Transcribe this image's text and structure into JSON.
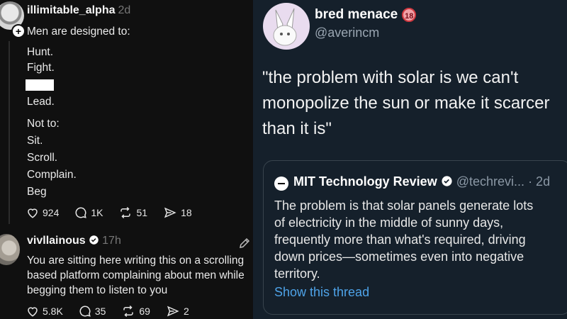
{
  "thread": {
    "post1": {
      "username": "illimitable_alpha",
      "time": "2d",
      "lines": [
        "Men are designed to:",
        "Hunt.",
        "Fight.",
        "Lead.",
        "Not to:",
        "Sit.",
        "Scroll.",
        "Complain.",
        "Beg"
      ],
      "likes": "924",
      "replies": "1K",
      "reposts": "51",
      "shares": "18"
    },
    "post2": {
      "username": "vivllainous",
      "time": "17h",
      "lines": [
        "You are sitting here writing this on a scrolling",
        "based platform complaining about men while",
        "begging them to listen to you"
      ],
      "likes": "5.8K",
      "replies": "35",
      "reposts": "69",
      "shares": "2"
    }
  },
  "tweet": {
    "name": "bred menace",
    "badge": "18",
    "handle": "@averincm",
    "lines": [
      "\"the problem with solar is we can't",
      "monopolize the sun or make it scarcer",
      "than it is\""
    ],
    "quote": {
      "name": "MIT Technology Review",
      "handle": "@techrevi...",
      "time": "· 2d",
      "lines": [
        "The problem is that solar panels generate lots",
        "of electricity in the middle of sunny days,",
        "frequently more than what's required, driving",
        "down prices—sometimes even into negative",
        "territory."
      ],
      "link": "Show this thread"
    }
  },
  "colors": {
    "link": "#4ea3e8",
    "verified": "#ffffff",
    "badge": "#f0a0a6"
  }
}
